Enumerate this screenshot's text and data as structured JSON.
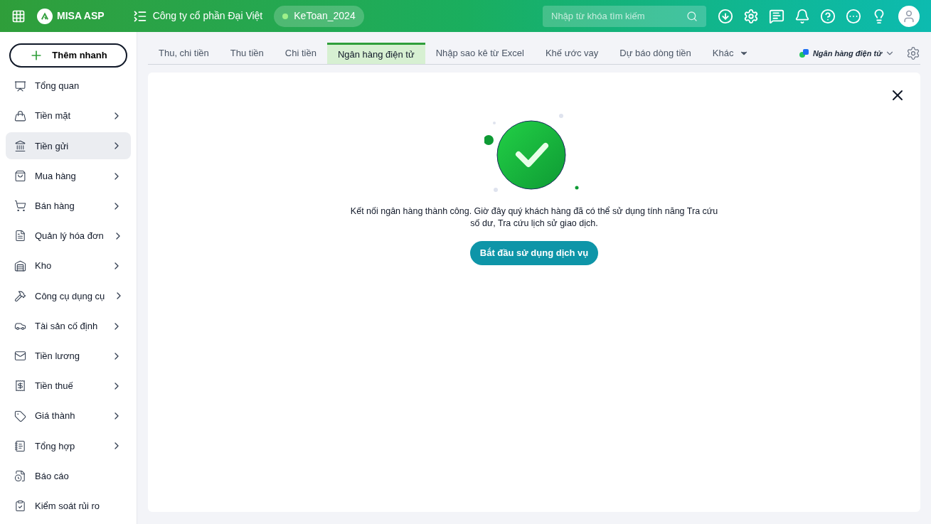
{
  "header": {
    "brand": "MISA ASP",
    "company": "Công ty cổ phần Đại Việt",
    "database": "KeToan_2024",
    "search": {
      "placeholder": "Nhập từ khóa tìm kiếm"
    }
  },
  "sidebar": {
    "quick_add": "Thêm nhanh",
    "items": [
      {
        "label": "Tổng quan",
        "selected": false,
        "has_submenu": false
      },
      {
        "label": "Tiền mặt",
        "selected": false,
        "has_submenu": true
      },
      {
        "label": "Tiền gửi",
        "selected": true,
        "has_submenu": true
      },
      {
        "label": "Mua hàng",
        "selected": false,
        "has_submenu": true
      },
      {
        "label": "Bán hàng",
        "selected": false,
        "has_submenu": true
      },
      {
        "label": "Quản lý hóa đơn",
        "selected": false,
        "has_submenu": true
      },
      {
        "label": "Kho",
        "selected": false,
        "has_submenu": true
      },
      {
        "label": "Công cụ dụng cụ",
        "selected": false,
        "has_submenu": true
      },
      {
        "label": "Tài sản cố định",
        "selected": false,
        "has_submenu": true
      },
      {
        "label": "Tiền lương",
        "selected": false,
        "has_submenu": true
      },
      {
        "label": "Tiền thuế",
        "selected": false,
        "has_submenu": true
      },
      {
        "label": "Giá thành",
        "selected": false,
        "has_submenu": true
      },
      {
        "label": "Tổng hợp",
        "selected": false,
        "has_submenu": true
      },
      {
        "label": "Báo cáo",
        "selected": false,
        "has_submenu": false
      },
      {
        "label": "Kiểm soát rủi ro",
        "selected": false,
        "has_submenu": false
      }
    ]
  },
  "tabs": [
    {
      "label": "Thu, chi tiền",
      "selected": false,
      "kind": "tab"
    },
    {
      "label": "Thu tiền",
      "selected": false,
      "kind": "tab"
    },
    {
      "label": "Chi tiền",
      "selected": false,
      "kind": "tab"
    },
    {
      "label": "Ngân hàng điện tử",
      "selected": true,
      "kind": "tab"
    },
    {
      "label": "Nhập sao kê từ Excel",
      "selected": false,
      "kind": "tab"
    },
    {
      "label": "Khế ước vay",
      "selected": false,
      "kind": "tab"
    },
    {
      "label": "Dự báo dòng tiền",
      "selected": false,
      "kind": "tab"
    },
    {
      "label": "Khác",
      "selected": false,
      "kind": "dropdown"
    }
  ],
  "bank_selector": "Ngân hàng điện tử",
  "content": {
    "message": "Kết nối ngân hàng thành công. Giờ đây quý khách hàng đã có thể sử dụng tính năng Tra cứu số dư, Tra cứu lịch sử giao dịch.",
    "button": "Bắt đầu sử dụng dịch vụ"
  }
}
